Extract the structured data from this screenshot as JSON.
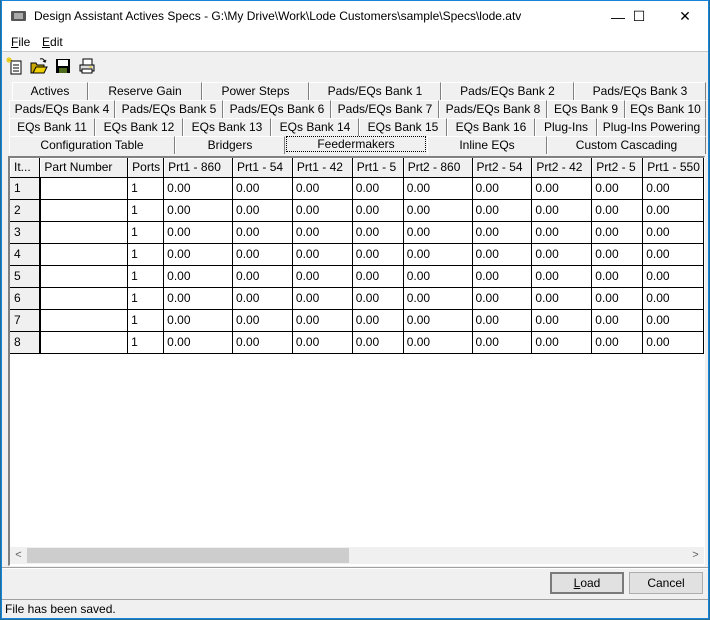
{
  "window": {
    "title": "Design Assistant Actives Specs - G:\\My Drive\\Work\\Lode Customers\\sample\\Specs\\lode.atv",
    "controls": {
      "minimize": "—",
      "maximize": "☐",
      "close": "✕"
    }
  },
  "menu": {
    "items": [
      {
        "label": "File",
        "mnemonic": "F",
        "rest": "ile"
      },
      {
        "label": "Edit",
        "mnemonic": "E",
        "rest": "dit"
      }
    ]
  },
  "toolbar": {
    "icons": [
      "new-file-icon",
      "open-folder-icon",
      "save-disk-icon",
      "print-icon"
    ]
  },
  "tabs": {
    "rows": [
      [
        "Actives",
        "Reserve Gain",
        "Power Steps",
        "Pads/EQs Bank 1",
        "Pads/EQs Bank 2",
        "Pads/EQs Bank 3"
      ],
      [
        "Pads/EQs Bank 4",
        "Pads/EQs Bank 5",
        "Pads/EQs Bank 6",
        "Pads/EQs Bank 7",
        "Pads/EQs Bank 8",
        "EQs Bank 9",
        "EQs Bank 10"
      ],
      [
        "EQs Bank 11",
        "EQs Bank 12",
        "EQs Bank 13",
        "EQs Bank 14",
        "EQs Bank 15",
        "EQs Bank 16",
        "Plug-Ins",
        "Plug-Ins Powering"
      ],
      [
        "Configuration Table",
        "Bridgers",
        "Feedermakers",
        "Inline EQs",
        "Custom Cascading"
      ]
    ],
    "active": "Feedermakers"
  },
  "grid": {
    "columns": [
      "It...",
      "Part Number",
      "Ports",
      "Prt1 - 860",
      "Prt1 - 54",
      "Prt1 - 42",
      "Prt1 - 5",
      "Prt2 - 860",
      "Prt2 - 54",
      "Prt2 - 42",
      "Prt2 - 5",
      "Prt1 - 550"
    ],
    "rows": [
      [
        "1",
        "",
        "1",
        "0.00",
        "0.00",
        "0.00",
        "0.00",
        "0.00",
        "0.00",
        "0.00",
        "0.00",
        "0.00"
      ],
      [
        "2",
        "",
        "1",
        "0.00",
        "0.00",
        "0.00",
        "0.00",
        "0.00",
        "0.00",
        "0.00",
        "0.00",
        "0.00"
      ],
      [
        "3",
        "",
        "1",
        "0.00",
        "0.00",
        "0.00",
        "0.00",
        "0.00",
        "0.00",
        "0.00",
        "0.00",
        "0.00"
      ],
      [
        "4",
        "",
        "1",
        "0.00",
        "0.00",
        "0.00",
        "0.00",
        "0.00",
        "0.00",
        "0.00",
        "0.00",
        "0.00"
      ],
      [
        "5",
        "",
        "1",
        "0.00",
        "0.00",
        "0.00",
        "0.00",
        "0.00",
        "0.00",
        "0.00",
        "0.00",
        "0.00"
      ],
      [
        "6",
        "",
        "1",
        "0.00",
        "0.00",
        "0.00",
        "0.00",
        "0.00",
        "0.00",
        "0.00",
        "0.00",
        "0.00"
      ],
      [
        "7",
        "",
        "1",
        "0.00",
        "0.00",
        "0.00",
        "0.00",
        "0.00",
        "0.00",
        "0.00",
        "0.00",
        "0.00"
      ],
      [
        "8",
        "",
        "1",
        "0.00",
        "0.00",
        "0.00",
        "0.00",
        "0.00",
        "0.00",
        "0.00",
        "0.00",
        "0.00"
      ]
    ]
  },
  "scrollbar": {
    "left_arrow": "<",
    "right_arrow": ">"
  },
  "buttons": {
    "load": {
      "label": "Load",
      "mnemonic": "L",
      "rest": "oad"
    },
    "cancel": {
      "label": "Cancel"
    }
  },
  "status": {
    "text": "File has been saved."
  }
}
